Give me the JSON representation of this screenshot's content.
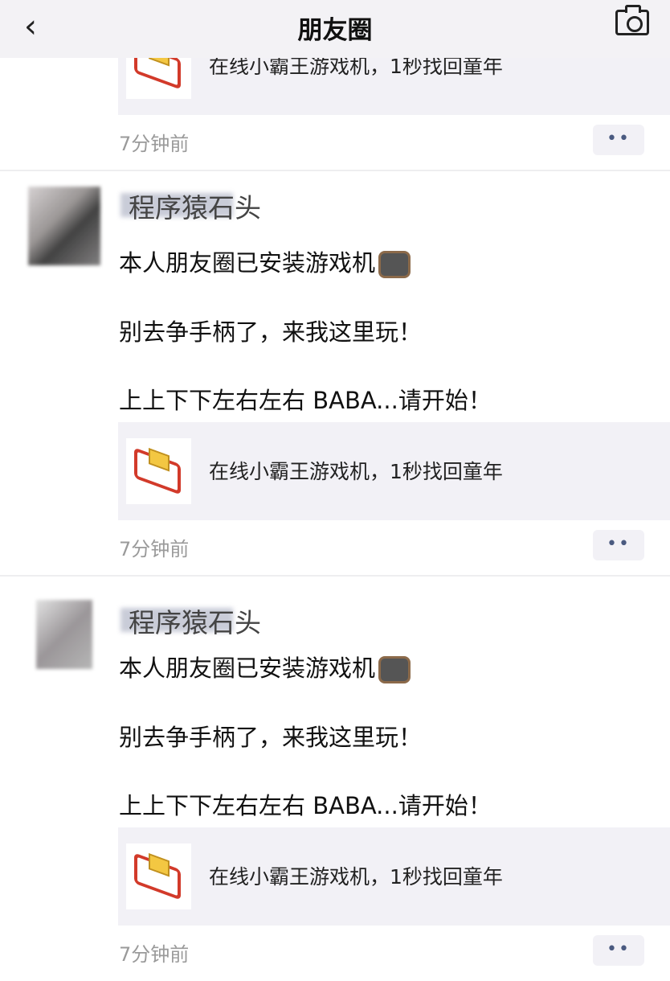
{
  "header": {
    "title": "朋友圈",
    "back_icon": "chevron-left-icon",
    "camera_icon": "camera-icon"
  },
  "posts": [
    {
      "card_text": "在线小霸王游戏机，1秒找回童年",
      "time": "7分钟前",
      "more": "••"
    },
    {
      "name": "程序猿石头",
      "lines": [
        "本人朋友圈已安装游戏机",
        "别去争手柄了，来我这里玩！",
        "上上下下左右左右 BABA...请开始！"
      ],
      "emoji": "television-emoji",
      "card_text": "在线小霸王游戏机，1秒找回童年",
      "time": "7分钟前",
      "more": "••"
    },
    {
      "name": "程序猿石头",
      "lines": [
        "本人朋友圈已安装游戏机",
        "别去争手柄了，来我这里玩！",
        "上上下下左右左右 BABA...请开始！"
      ],
      "emoji": "television-emoji",
      "card_text": "在线小霸王游戏机，1秒找回童年",
      "time": "7分钟前",
      "more": "••"
    }
  ]
}
